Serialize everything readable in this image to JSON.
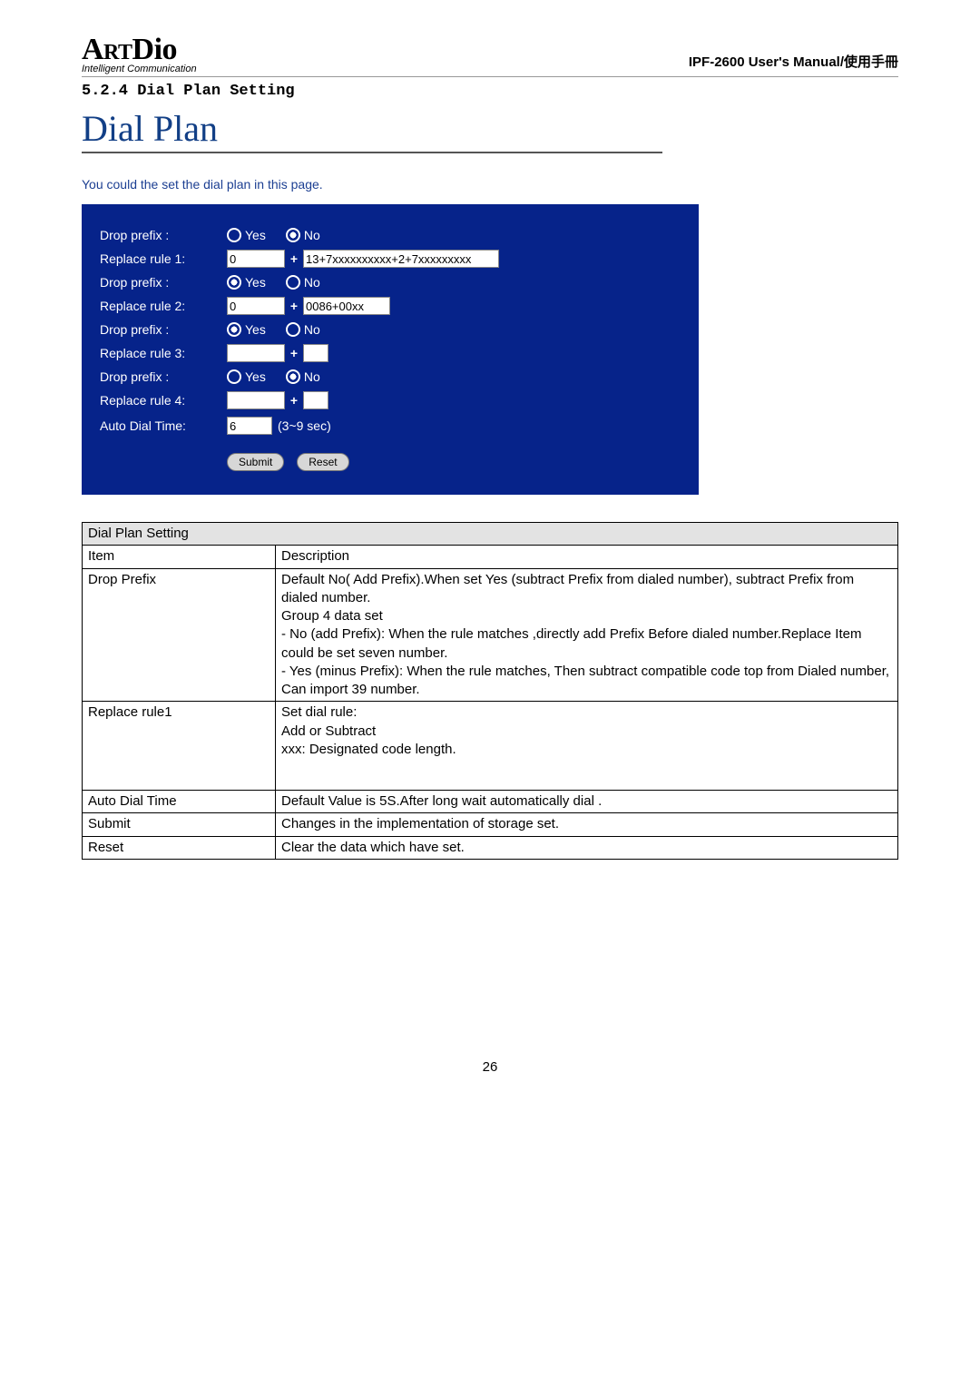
{
  "header": {
    "brand": "ArtDio",
    "tagline": "Intelligent Communication",
    "right": "IPF-2600 User's Manual/使用手冊"
  },
  "section_no": "5.2.4 Dial Plan Setting",
  "title": "Dial Plan",
  "subtitle": "You could the set the dial plan in this page.",
  "form": {
    "drop_label": "Drop prefix :",
    "yes": "Yes",
    "no": "No",
    "replace1_label": "Replace rule 1:",
    "r1_a": "0",
    "r1_b": "13+7xxxxxxxxxx+2+7xxxxxxxxx",
    "replace2_label": "Replace rule 2:",
    "r2_a": "0",
    "r2_b": "0086+00xx",
    "replace3_label": "Replace rule 3:",
    "r3_a": "",
    "r3_b": "",
    "replace4_label": "Replace rule 4:",
    "r4_a": "",
    "r4_b": "",
    "autodial_label": "Auto Dial Time:",
    "autodial_val": "6",
    "autodial_note": "(3~9 sec)",
    "submit": "Submit",
    "reset": "Reset"
  },
  "table": {
    "heading": "Dial Plan Setting",
    "h_item": "Item",
    "h_desc": "Description",
    "r_dropprefix": "Drop Prefix",
    "r_dropprefix_desc": "Default No( Add Prefix).When set Yes (subtract Prefix from dialed number), subtract Prefix from dialed number.\nGroup 4 data set\n- No (add Prefix): When the rule matches ,directly add Prefix Before dialed number.Replace Item could be set seven number.\n- Yes (minus Prefix): When the rule matches, Then subtract compatible code top from Dialed number, Can import 39 number.",
    "r_replace": "Replace rule1",
    "r_replace_desc": "Set dial rule:\nAdd or Subtract\nxxx: Designated code length.",
    "r_auto": "Auto Dial Time",
    "r_auto_desc": "Default Value is 5S.After long wait automatically dial .",
    "r_submit": "Submit",
    "r_submit_desc": "Changes in the implementation of storage set.",
    "r_reset": "Reset",
    "r_reset_desc": "Clear the data which have set."
  },
  "pageno": "26"
}
